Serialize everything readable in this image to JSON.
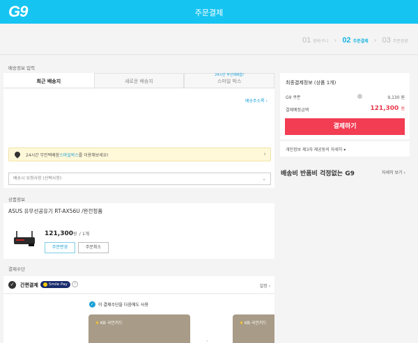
{
  "header": {
    "logo": "G9",
    "title": "주문결제"
  },
  "steps": [
    {
      "num": "01",
      "label": "장바구니",
      "active": false
    },
    {
      "num": "02",
      "label": "주문결제",
      "active": true
    },
    {
      "num": "03",
      "label": "주문완료",
      "active": false
    }
  ],
  "shipping": {
    "section_title": "배송정보 입력",
    "tabs": [
      {
        "label": "최근 배송지",
        "badge": ""
      },
      {
        "label": "새로운 배송지",
        "badge": ""
      },
      {
        "label": "스마일 박스",
        "badge": "24시간 무인택배함!"
      }
    ],
    "address_book": "배송주소록 ›",
    "banner_pre": "24시간 무인택배함 ",
    "banner_link": "스마일박스",
    "banner_post": "를 이용해보세요!",
    "request_placeholder": "배송시 요청사항 (선택사항)"
  },
  "product": {
    "section_title": "상품정보",
    "name": "ASUS 유무선공유기 RT-AX56U /완전정품",
    "price": "121,300",
    "price_unit": "원",
    "qty": "/ 1개",
    "change_label": "주문변경",
    "cancel_label": "주문취소"
  },
  "payment": {
    "section_title": "결제수단",
    "easypay_label": "간편결제",
    "smilepay_label": "Smile Pay",
    "setting_label": "설정 ›",
    "use_next_label": "이 결제수단을 다음에도 사용",
    "cards": [
      {
        "label": "KB 국민카드"
      },
      {
        "label": "KB 국민카드"
      }
    ]
  },
  "summary": {
    "title": "최종결제정보 (상품 1개)",
    "coupon_label": "G9 쿠폰",
    "coupon_value": "9,130 원",
    "total_label": "결제예정금액",
    "total_value": "121,300",
    "total_unit": "원",
    "pay_button": "결제하기",
    "privacy_link": "개인정보 제3자 제공동의 자세히 ▾"
  },
  "promo": {
    "text": "배송비 반품비 걱정없는 G9",
    "link": "자세히 보기 ›"
  },
  "colors": {
    "brand": "#16c4f2",
    "pay_button": "#f23d53",
    "link": "#1a9fd6"
  }
}
